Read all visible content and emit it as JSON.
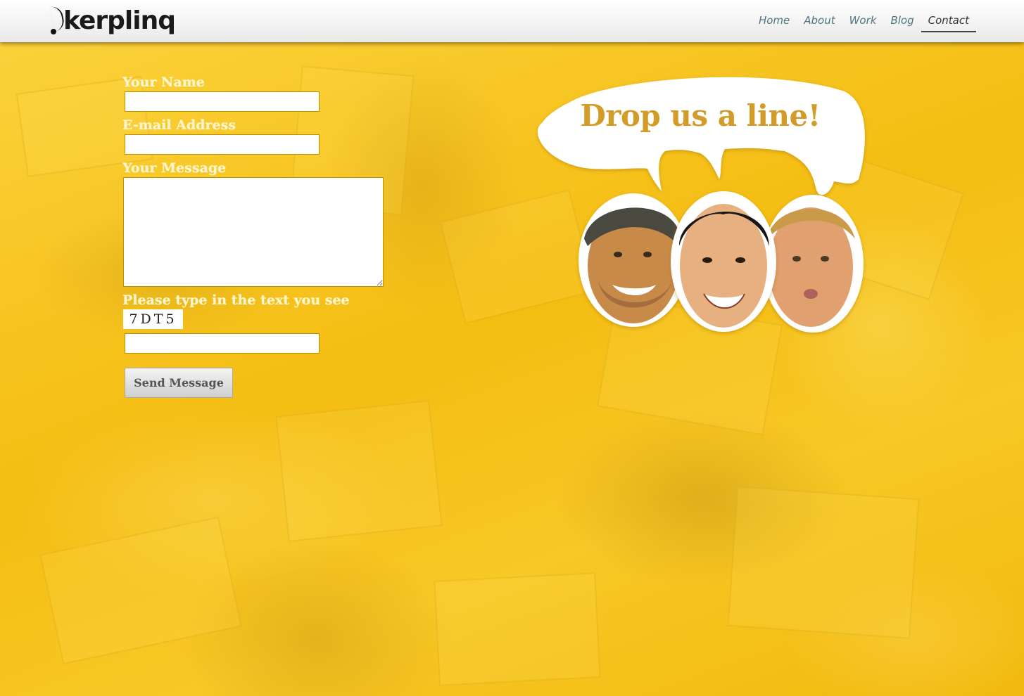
{
  "header": {
    "logo_text": "kerplinq",
    "nav": [
      {
        "label": "Home",
        "active": false
      },
      {
        "label": "About",
        "active": false
      },
      {
        "label": "Work",
        "active": false
      },
      {
        "label": "Blog",
        "active": false
      },
      {
        "label": "Contact",
        "active": true
      }
    ]
  },
  "form": {
    "name_label": "Your Name",
    "name_value": "",
    "email_label": "E-mail Address",
    "email_value": "",
    "message_label": "Your Message",
    "message_value": "",
    "captcha_label": "Please type in the text you see",
    "captcha_text": "7DT5",
    "captcha_value": "",
    "send_label": "Send Message"
  },
  "bubble": {
    "text": "Drop us a line!"
  },
  "colors": {
    "background": "#f7c316",
    "nav_link": "#4d7580",
    "bubble_text": "#d39c28",
    "label_text": "#fff6d0"
  },
  "icons": [
    "logo-mark-icon"
  ]
}
